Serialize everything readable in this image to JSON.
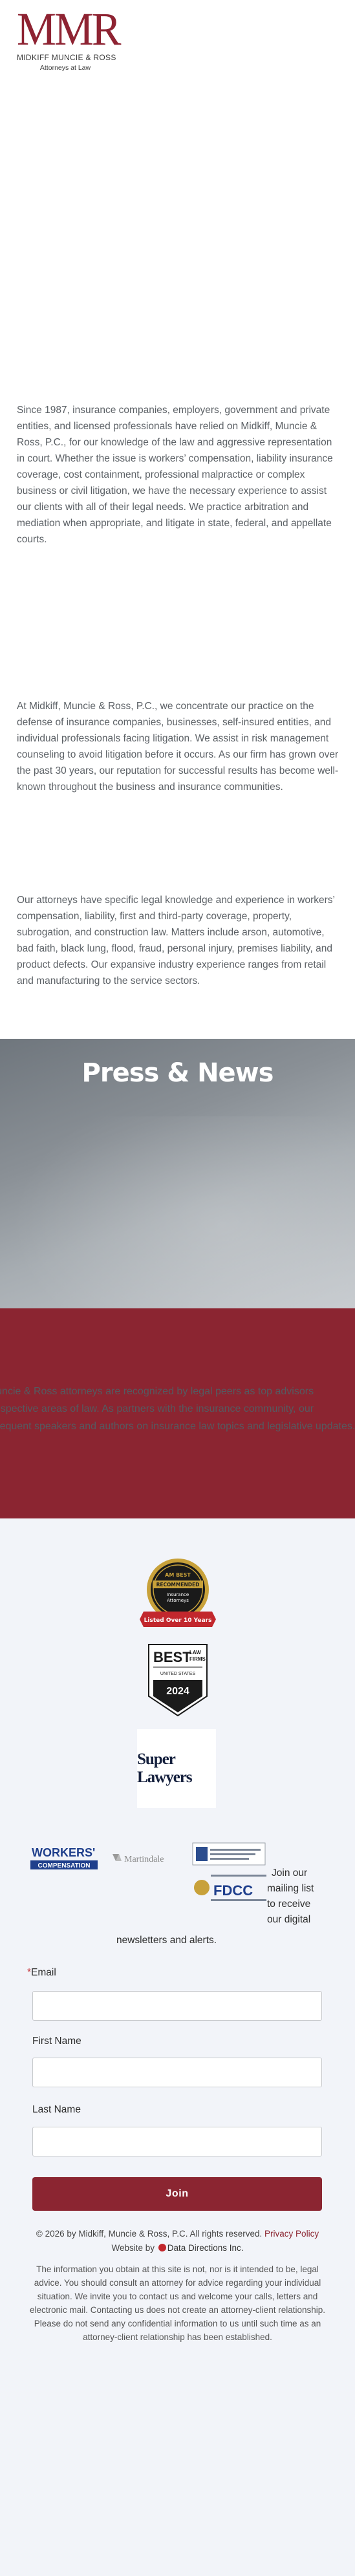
{
  "logo": {
    "mark": "MMR",
    "firm_name": "MIDKIFF MUNCIE & ROSS",
    "tagline": "Attorneys at Law"
  },
  "intro": {
    "paragraph_1": "Since 1987, insurance companies, employers, government and private entities, and licensed professionals have relied on Midkiff, Muncie & Ross, P.C., for our knowledge of the law and aggressive representation in court. Whether the issue is workers’ compensation, liability insurance coverage, cost containment, professional malpractice or complex business or civil litigation, we have the necessary experience to assist our clients with all of their legal needs. We practice arbitration and mediation when appropriate, and litigate in state, federal, and appellate courts.",
    "paragraph_2": "At Midkiff, Muncie & Ross, P.C., we concentrate our practice on the defense of insurance companies, businesses, self-insured entities, and individual professionals facing litigation. We assist in risk management counseling to avoid litigation before it occurs. As our firm has grown over the past 30 years, our reputation for successful results has become well-known throughout the business and insurance communities.",
    "paragraph_3": "Our attorneys have specific legal knowledge and experience in workers’ compensation, liability, first and third-party coverage, property, subrogation, and construction law. Matters include arson, automotive, bad faith, black lung, flood, fraud, personal injury, premises liability, and product defects. Our expansive industry experience ranges from retail and manufacturing to the service sectors."
  },
  "press": {
    "title": "Press & News"
  },
  "recognition": {
    "line_1": "Midkiff, Muncie & Ross attorneys are recognized by legal peers as top advisors",
    "line_2": "in their respective areas of law. As partners with the insurance community, our",
    "line_3": "attorneys are frequent speakers and authors on insurance law topics and legislative updates."
  },
  "badges": {
    "avvo_top": "AM BEST",
    "avvo_mid": "RECOMMENDED",
    "avvo_sub1": "Insurance",
    "avvo_sub2": "Attorneys",
    "avvo_ribbon": "Listed Over 10 Years",
    "best_law_1": "BEST",
    "best_law_2": "LAW",
    "best_law_3": "FIRMS",
    "best_law_4": "UNITED STATES",
    "best_law_year": "2024",
    "super_lawyers": "Super Lawyers"
  },
  "logos": {
    "wc_top": "WORKERS'",
    "wc_bottom": "COMPENSATION",
    "martindale": "Martindale",
    "fdcc": "FDCC"
  },
  "newsletter": {
    "line_1": "Join our",
    "line_2": "mailing list",
    "line_3": "to receive",
    "line_4": "our digital",
    "line_5": "newsletters and alerts."
  },
  "form": {
    "email_label": "Email",
    "first_name_label": "First Name",
    "last_name_label": "Last Name",
    "join_label": "Join"
  },
  "footer": {
    "copyright": "© 2026 by Midkiff, Muncie & Ross, P.C. All rights reserved.",
    "privacy": "Privacy Policy",
    "website_by": "Website by",
    "dd": "Data Directions Inc.",
    "disclaimer": "The information you obtain at this site is not, nor is it intended to be, legal advice. You should consult an attorney for advice regarding your individual situation. We invite you to contact us and welcome your calls, letters and electronic mail. Contacting us does not create an attorney-client relationship. Please do not send any confidential information to us until such time as an attorney-client relationship has been established."
  },
  "colors": {
    "brand_red": "#8b2531",
    "press_gray": "#8a9096",
    "footer_bg": "#f2f4f9"
  }
}
